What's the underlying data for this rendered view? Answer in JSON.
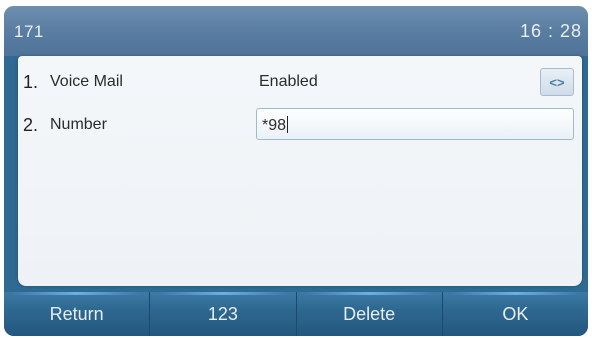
{
  "statusbar": {
    "line_id": "171",
    "time": "16 : 28"
  },
  "rows": [
    {
      "number": "1.",
      "label": "Voice Mail",
      "value": "Enabled",
      "switch_icon": "left-right-arrows-icon",
      "switch_glyph": "<>"
    },
    {
      "number": "2.",
      "label": "Number",
      "input_value": "*98"
    }
  ],
  "softkeys": [
    {
      "label": "Return"
    },
    {
      "label": "123"
    },
    {
      "label": "Delete"
    },
    {
      "label": "OK"
    }
  ],
  "colors": {
    "statusbar": "#5b7fa3",
    "softkey": "#2e6890",
    "panel": "#f4f7fa",
    "accent": "#4a7ea8"
  }
}
